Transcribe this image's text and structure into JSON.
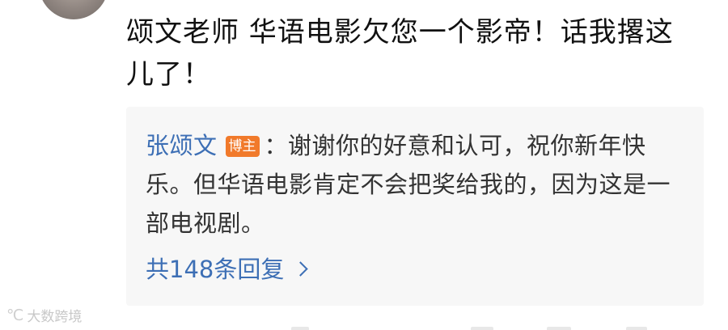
{
  "comment": {
    "text": "颂文老师 华语电影欠您一个影帝！话我撂这儿了！"
  },
  "reply": {
    "author": "张颂文",
    "badge": "博主",
    "separator": "：",
    "text": "谢谢你的好意和认可，祝你新年快乐。但华语电影肯定不会把奖给我的，因为这是一部电视剧。"
  },
  "reply_count": {
    "label": "共148条回复"
  },
  "watermark": {
    "logo_glyph": "℃",
    "text": "大数跨境"
  },
  "colors": {
    "link_blue": "#3d6fb5",
    "badge_orange": "#f17a2b",
    "reply_bg": "#f7f7f7"
  }
}
